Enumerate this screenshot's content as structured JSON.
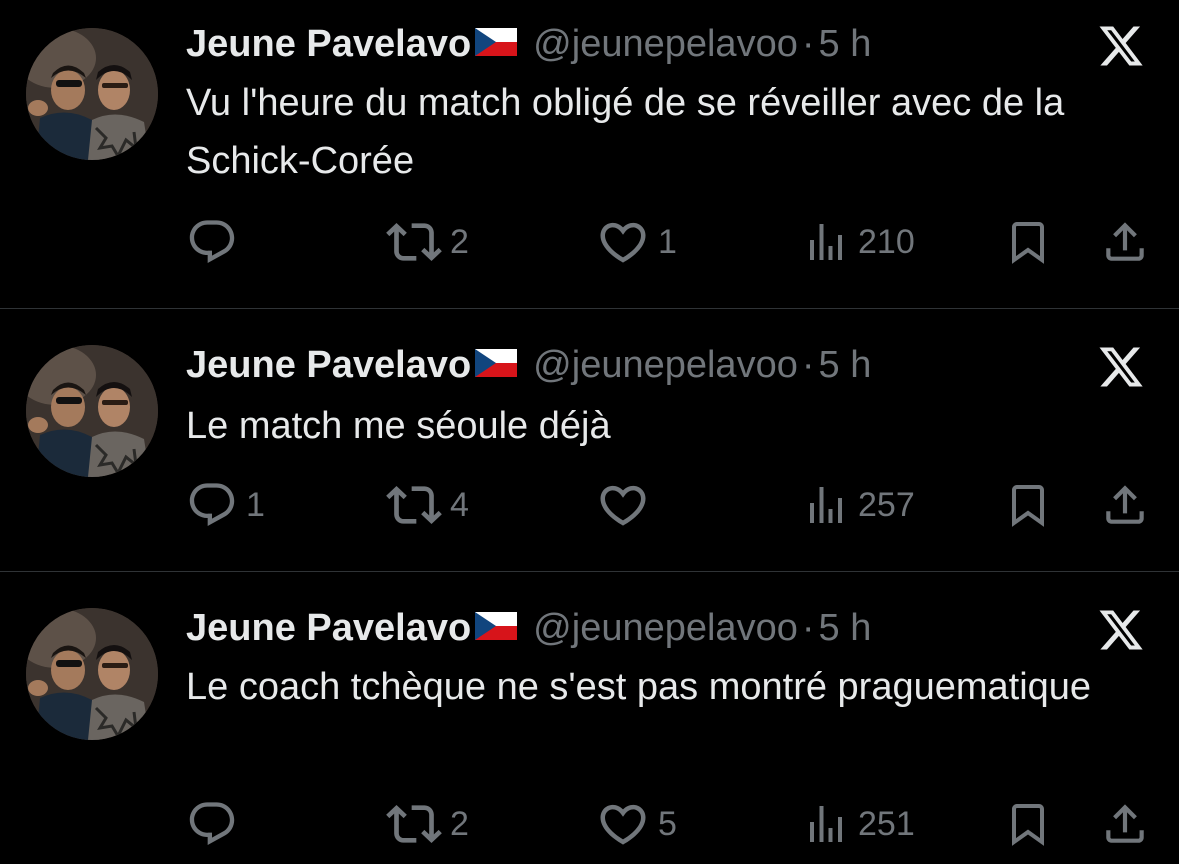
{
  "tweets": [
    {
      "author_name": "Jeune Pavelavo",
      "handle": "@jeunepelavoo",
      "separator": "·",
      "time": "5 h",
      "text": "Vu l'heure du match obligé de se réveiller avec de la Schick-Corée",
      "replies": "",
      "retweets": "2",
      "likes": "1",
      "views": "210"
    },
    {
      "author_name": "Jeune Pavelavo",
      "handle": "@jeunepelavoo",
      "separator": "·",
      "time": "5 h",
      "text": "Le match me séoule déjà",
      "replies": "1",
      "retweets": "4",
      "likes": "",
      "views": "257"
    },
    {
      "author_name": "Jeune Pavelavo",
      "handle": "@jeunepelavoo",
      "separator": "·",
      "time": "5 h",
      "text": "Le coach tchèque ne s'est pas montré praguematique",
      "replies": "",
      "retweets": "2",
      "likes": "5",
      "views": "251"
    }
  ],
  "icons": {
    "flag": "czech-flag-icon",
    "logo": "x-logo-icon",
    "reply": "reply-icon",
    "retweet": "retweet-icon",
    "like": "heart-icon",
    "views": "views-icon",
    "bookmark": "bookmark-icon",
    "share": "share-icon"
  },
  "colors": {
    "background": "#000000",
    "text": "#e7e9ea",
    "muted": "#71767b",
    "divider": "#2f3336"
  }
}
